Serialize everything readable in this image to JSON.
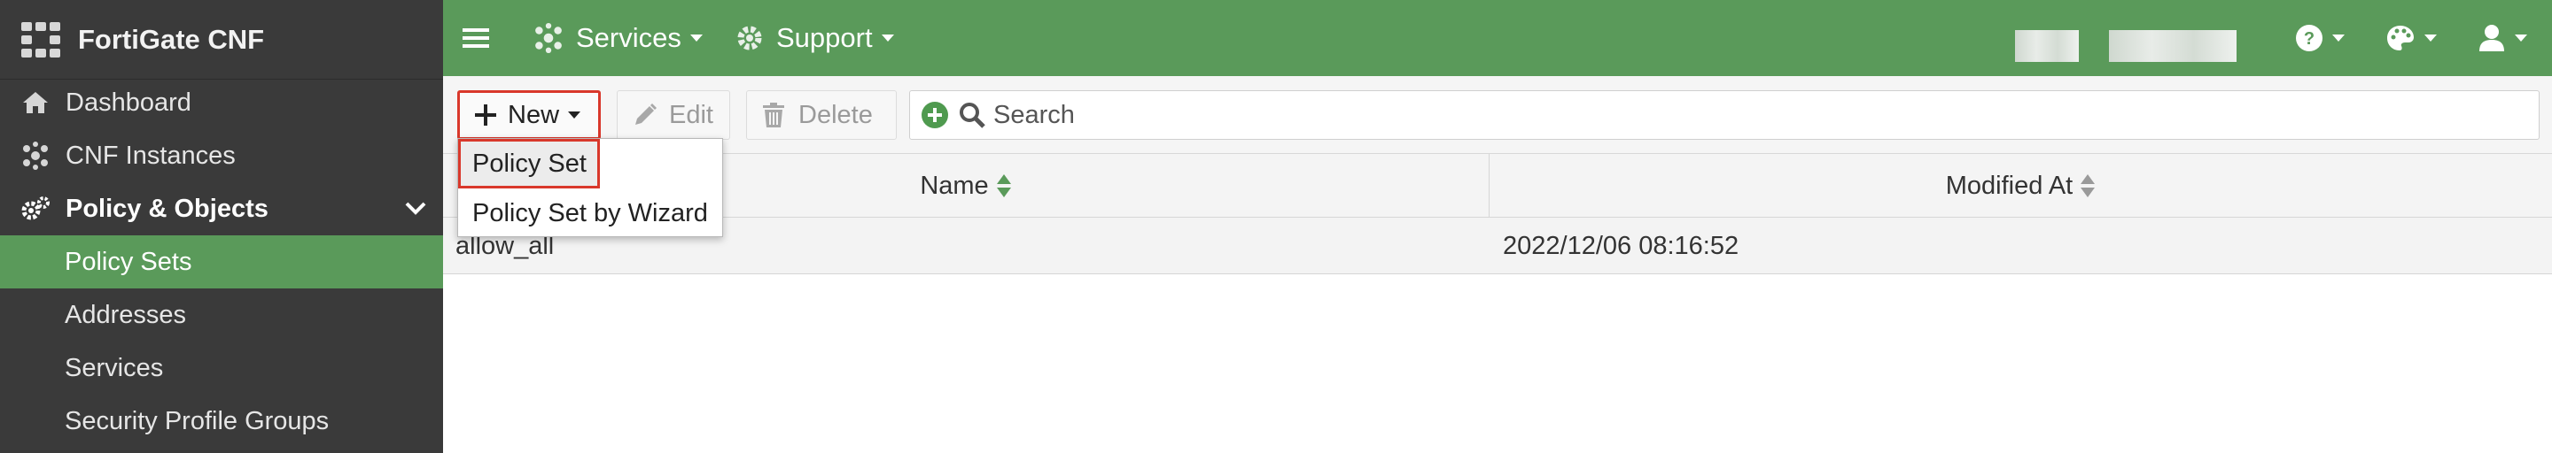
{
  "sidebar": {
    "brand": "FortiGate CNF",
    "items": [
      {
        "label": "Dashboard",
        "icon": "home-icon"
      },
      {
        "label": "CNF Instances",
        "icon": "cluster-icon"
      },
      {
        "label": "Policy & Objects",
        "icon": "cogs-icon"
      },
      {
        "label": "Policy Sets"
      },
      {
        "label": "Addresses"
      },
      {
        "label": "Services"
      },
      {
        "label": "Security Profile Groups"
      }
    ]
  },
  "topbar": {
    "services_label": "Services",
    "support_label": "Support"
  },
  "toolbar": {
    "new_label": "New",
    "edit_label": "Edit",
    "delete_label": "Delete",
    "search_placeholder": "Search"
  },
  "new_menu": {
    "items": [
      "Policy Set",
      "Policy Set by Wizard"
    ]
  },
  "table": {
    "columns": [
      "Name",
      "Modified At"
    ],
    "rows": [
      {
        "name": "allow_all",
        "modified_at": "2022/12/06 08:16:52"
      }
    ]
  },
  "colors": {
    "accent_green": "#5a9a5a",
    "sidebar_bg": "#3a3a3a",
    "highlight_red": "#d9382b"
  }
}
